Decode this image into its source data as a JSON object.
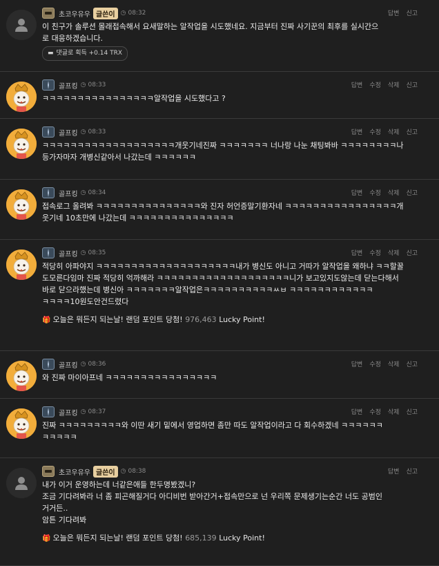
{
  "comments": [
    {
      "nick": "초코우유우",
      "badge": "글쓴이",
      "time": "08:32",
      "avatar": "default",
      "actions": [
        "답변",
        "신고"
      ],
      "lines": [
        "이 친구가 솔루션 몰래접속해서 요새말하는 알작업을 시도했네요. 지금부터 진짜 사기꾼의 최후를 실시간으",
        "로 대응하겠습니다."
      ],
      "reward": "댓글로 획득 +0.14 TRX"
    },
    {
      "nick": "골프킹",
      "time": "08:33",
      "avatar": "golf",
      "actions": [
        "답변",
        "수정",
        "삭제",
        "신고"
      ],
      "lines": [
        "ㅋㅋㅋㅋㅋㅋㅋㅋㅋㅋㅋㅋㅋㅋㅋㅋ알작업을 시도했다고 ?"
      ]
    },
    {
      "nick": "골프킹",
      "time": "08:33",
      "avatar": "golf",
      "actions": [
        "답변",
        "수정",
        "삭제",
        "신고"
      ],
      "lines": [
        "ㅋㅋㅋㅋㅋㅋㅋㅋㅋㅋㅋㅋㅋㅋㅋㅋㅋㅋㅋ개웃기네진짜 ㅋㅋㅋㅋㅋㅋㅋ 너나랑 나눈 채팅봐바 ㅋㅋㅋㅋㅋㅋㅋㅋ나",
        "등가자마자 개병신같아서 나갔는데 ㅋㅋㅋㅋㅋㅋ"
      ]
    },
    {
      "nick": "골프킹",
      "time": "08:34",
      "avatar": "golf",
      "actions": [
        "답변",
        "수정",
        "삭제",
        "신고"
      ],
      "lines": [
        "접속로그 올려봐 ㅋㅋㅋㅋㅋㅋㅋㅋㅋㅋㅋㅋㅋㅋㅋ와 진자 허언증말기환자네 ㅋㅋㅋㅋㅋㅋㅋㅋㅋㅋㅋㅋㅋㅋㅋㅋ개",
        "웃기네 10초만에 나갔는데 ㅋㅋㅋㅋㅋㅋㅋㅋㅋㅋㅋㅋㅋㅋㅋ"
      ]
    },
    {
      "nick": "골프킹",
      "time": "08:35",
      "avatar": "golf",
      "actions": [
        "답변",
        "수정",
        "삭제",
        "신고"
      ],
      "lines": [
        "적당히 아파야지 ㅋㅋㅋㅋㅋㅋㅋㅋㅋㅋㅋㅋㅋㅋㅋㅋㅋㅋㅋㅋ내가 병신도 아니고 거따가 알작업을 왜하냐 ㅋㅋ할꿀",
        "도모른다임마 진짜 적당히 억까해라 ㅋㅋㅋㅋㅋㅋㅋㅋㅋㅋㅋㅋㅋㅋㅋㅋㅋㅋㅋ니가 보고있지도않는데 닫는다해서",
        "바로 닫으라했는데 병신아 ㅋㅋㅋㅋㅋㅋㅋ알작업은ㅋㅋㅋㅋㅋㅋㅋㅋㅋㅋㅆㅂ ㅋㅋㅋㅋㅋㅋㅋㅋㅋㅋㅋㅋ",
        "ㅋㅋㅋㅋ10원도안건드렸다"
      ],
      "lucky": {
        "prefix": "오늘은 뭐든지 되는날! 랜덤 포인트 당첨!",
        "points": "976,463",
        "suffix": "Lucky Point!"
      }
    },
    {
      "nick": "골프킹",
      "time": "08:36",
      "avatar": "golf",
      "actions": [
        "답변",
        "수정",
        "삭제",
        "신고"
      ],
      "lines": [
        "와 진짜 마이아프네 ㅋㅋㅋㅋㅋㅋㅋㅋㅋㅋㅋㅋㅋㅋㅋㅋ"
      ]
    },
    {
      "nick": "골프킹",
      "time": "08:37",
      "avatar": "golf",
      "actions": [
        "답변",
        "수정",
        "삭제",
        "신고"
      ],
      "lines": [
        "진짜 ㅋㅋㅋㅋㅋㅋㅋㅋㅋ와 이딴 새기 밑에서 영업하면 좀만 따도 알작업이라고 다 회수하겠네 ㅋㅋㅋㅋㅋㅋ",
        "ㅋㅋㅋㅋㅋ"
      ]
    },
    {
      "nick": "초코우유우",
      "badge": "글쓴이",
      "time": "08:38",
      "avatar": "default",
      "actions": [
        "답변",
        "신고"
      ],
      "lines": [
        "내가 이거 운영하는데 너같은애들 한두명봤겠니?",
        "조금 기다려봐라 너 좀 피곤해질거다 아디비번 받아간거+접속만으로 넌 우리쪽 문제생기는순간 너도 공범인",
        "거거든..",
        "암튼 기다려봐"
      ],
      "lucky": {
        "prefix": "오늘은 뭐든지 되는날! 랜덤 포인트 당첨!",
        "points": "685,139",
        "suffix": "Lucky Point!"
      }
    }
  ]
}
